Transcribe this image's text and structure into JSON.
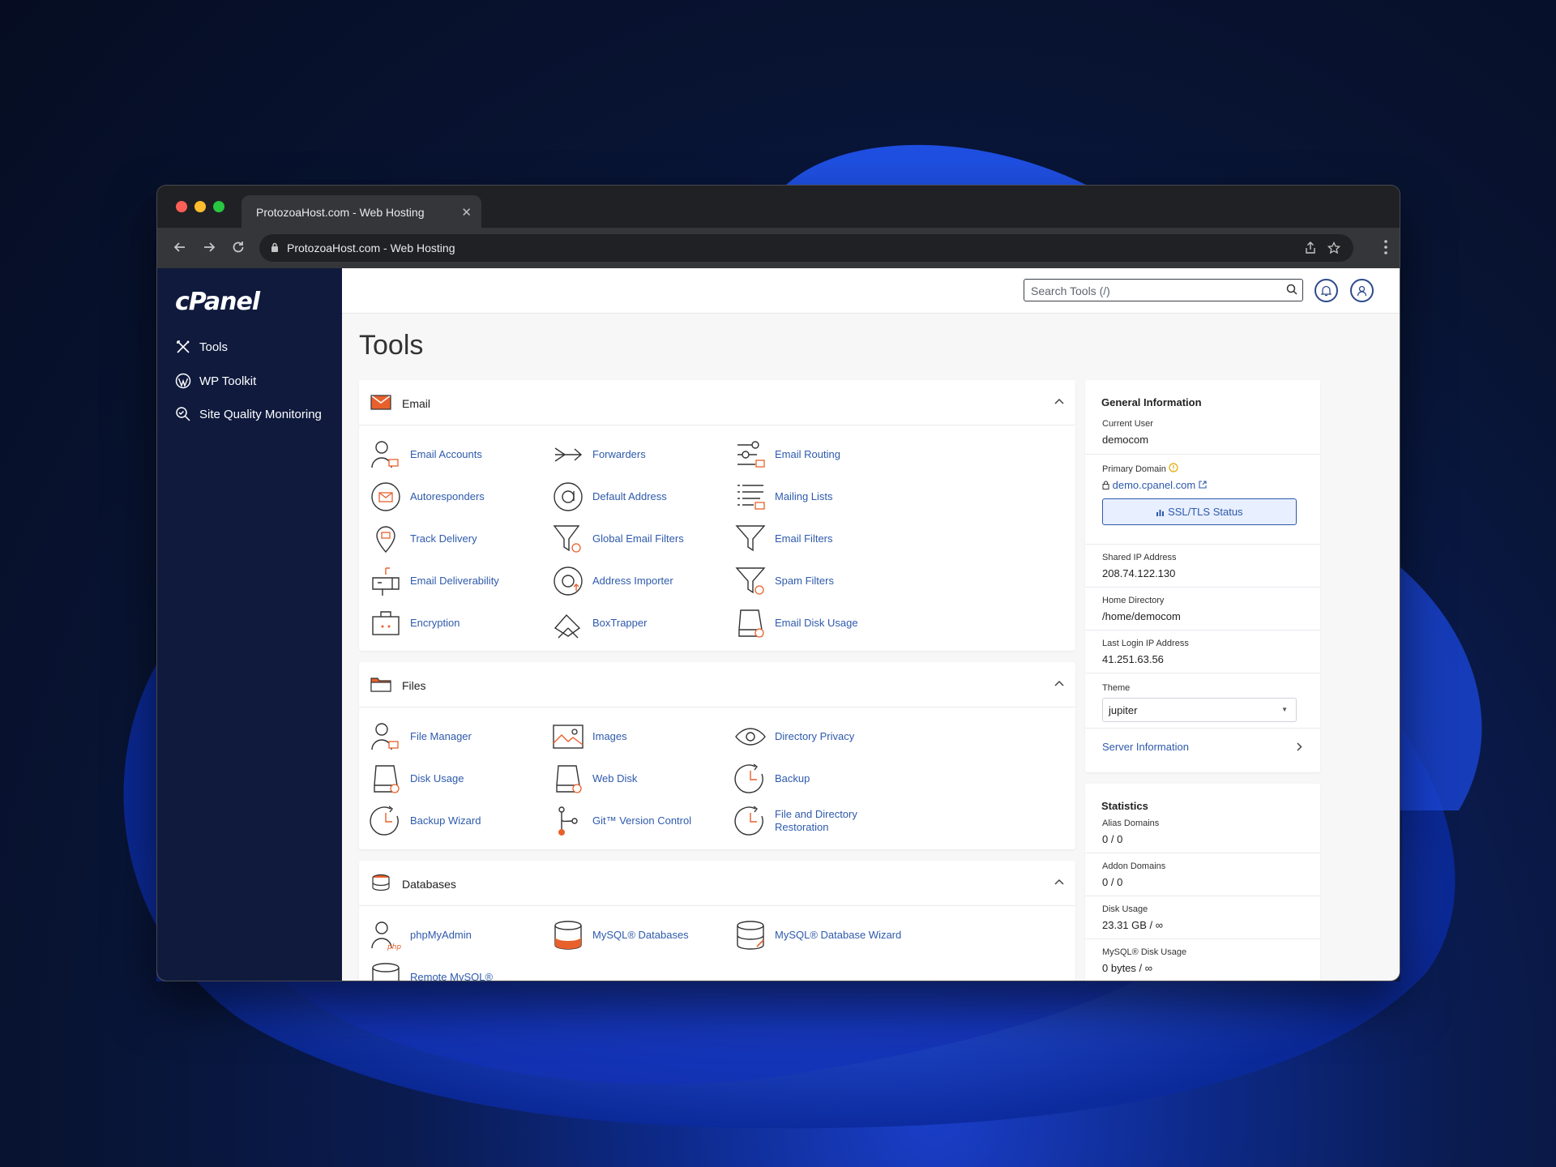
{
  "browser": {
    "tab_title": "ProtozoaHost.com - Web Hosting",
    "address": "ProtozoaHost.com - Web Hosting"
  },
  "sidebar": {
    "logo": "cPanel",
    "items": [
      {
        "label": "Tools",
        "icon": "tools-icon"
      },
      {
        "label": "WP Toolkit",
        "icon": "wordpress-icon"
      },
      {
        "label": "Site Quality Monitoring",
        "icon": "site-quality-icon"
      }
    ]
  },
  "topbar": {
    "search_placeholder": "Search Tools (/)"
  },
  "page": {
    "title": "Tools"
  },
  "sections": {
    "email": {
      "title": "Email",
      "tools": [
        "Email Accounts",
        "Forwarders",
        "Email Routing",
        "Autoresponders",
        "Default Address",
        "Mailing Lists",
        "Track Delivery",
        "Global Email Filters",
        "Email Filters",
        "Email Deliverability",
        "Address Importer",
        "Spam Filters",
        "Encryption",
        "BoxTrapper",
        "Email Disk Usage"
      ]
    },
    "files": {
      "title": "Files",
      "tools": [
        "File Manager",
        "Images",
        "Directory Privacy",
        "Disk Usage",
        "Web Disk",
        "Backup",
        "Backup Wizard",
        "Git™ Version Control",
        "File and Directory Restoration"
      ]
    },
    "databases": {
      "title": "Databases",
      "tools": [
        "phpMyAdmin",
        "MySQL® Databases",
        "MySQL® Database Wizard",
        "Remote MySQL®"
      ]
    }
  },
  "general_info": {
    "title": "General Information",
    "current_user_label": "Current User",
    "current_user": "democom",
    "primary_domain_label": "Primary Domain",
    "primary_domain": "demo.cpanel.com",
    "ssl_button": "SSL/TLS Status",
    "shared_ip_label": "Shared IP Address",
    "shared_ip": "208.74.122.130",
    "home_dir_label": "Home Directory",
    "home_dir": "/home/democom",
    "last_login_label": "Last Login IP Address",
    "last_login": "41.251.63.56",
    "theme_label": "Theme",
    "theme": "jupiter",
    "server_info": "Server Information"
  },
  "statistics": {
    "title": "Statistics",
    "rows": [
      {
        "label": "Alias Domains",
        "value": "0 / 0"
      },
      {
        "label": "Addon Domains",
        "value": "0 / 0"
      },
      {
        "label": "Disk Usage",
        "value": "23.31 GB / ∞"
      },
      {
        "label": "MySQL® Disk Usage",
        "value": "0 bytes / ∞"
      }
    ]
  },
  "colors": {
    "accent": "#2e5aac",
    "sidebar": "#0f1a3d",
    "icon_orange": "#e8602c"
  }
}
